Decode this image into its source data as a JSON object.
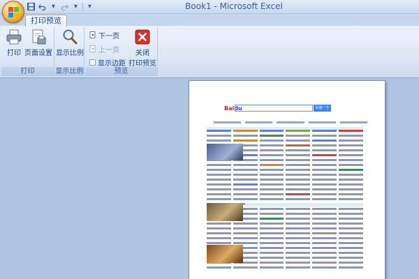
{
  "window": {
    "title": "Book1 - Microsoft Excel"
  },
  "quick_access": {
    "save_icon": "save-icon",
    "undo_icon": "undo-icon",
    "redo_icon": "redo-icon",
    "more": "▾"
  },
  "tabs": [
    {
      "label": "打印预览",
      "active": true
    }
  ],
  "ribbon": {
    "groups": [
      {
        "label": "打印",
        "buttons": [
          {
            "label": "打印",
            "icon": "printer-icon"
          },
          {
            "label": "页面设置",
            "icon": "page-setup-icon"
          }
        ]
      },
      {
        "label": "显示比例",
        "buttons": [
          {
            "label": "显示比例",
            "icon": "zoom-icon"
          }
        ]
      },
      {
        "label": "预览",
        "small_buttons": [
          {
            "label": "下一页",
            "enabled": true
          },
          {
            "label": "上一页",
            "enabled": false
          }
        ],
        "checkbox": {
          "label": "显示边距",
          "checked": false
        },
        "close": {
          "line1": "关闭",
          "line2": "打印预览",
          "icon": "close-icon"
        }
      }
    ]
  },
  "preview": {
    "search_button": "百度一下"
  },
  "colors": {
    "accent": "#15428b",
    "ribbon": "#dde8f6",
    "workspace": "#aec4e2",
    "close_red": "#d9302c"
  }
}
